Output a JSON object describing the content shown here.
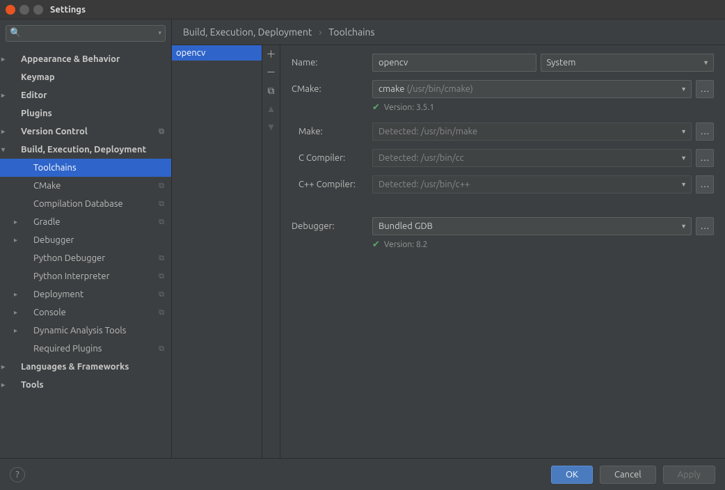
{
  "window": {
    "title": "Settings"
  },
  "search": {
    "placeholder": ""
  },
  "tree": {
    "appearance": "Appearance & Behavior",
    "keymap": "Keymap",
    "editor": "Editor",
    "plugins": "Plugins",
    "vcs": "Version Control",
    "build": "Build, Execution, Deployment",
    "toolchains": "Toolchains",
    "cmake": "CMake",
    "compdb": "Compilation Database",
    "gradle": "Gradle",
    "debugger": "Debugger",
    "pydebug": "Python Debugger",
    "pyinterp": "Python Interpreter",
    "deployment": "Deployment",
    "console": "Console",
    "dyn": "Dynamic Analysis Tools",
    "reqplugins": "Required Plugins",
    "lang": "Languages & Frameworks",
    "tools": "Tools"
  },
  "breadcrumb": {
    "a": "Build, Execution, Deployment",
    "b": "Toolchains"
  },
  "tclist": {
    "item0": "opencv"
  },
  "form": {
    "name_label": "Name:",
    "name_value": "opencv",
    "system_label": "System",
    "cmake_label": "CMake:",
    "cmake_value": "cmake",
    "cmake_path": "(/usr/bin/cmake)",
    "cmake_version": "Version: 3.5.1",
    "make_label": "Make:",
    "make_value": "Detected: /usr/bin/make",
    "cc_label": "C Compiler:",
    "cc_value": "Detected: /usr/bin/cc",
    "cxx_label": "C++ Compiler:",
    "cxx_value": "Detected: /usr/bin/c++",
    "debugger_label": "Debugger:",
    "debugger_value": "Bundled GDB",
    "debugger_version": "Version: 8.2"
  },
  "footer": {
    "ok": "OK",
    "cancel": "Cancel",
    "apply": "Apply"
  }
}
